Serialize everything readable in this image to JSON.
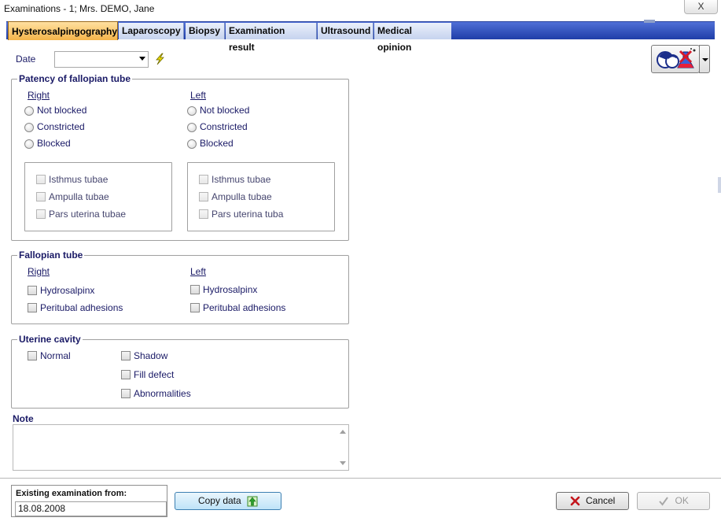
{
  "window": {
    "title": "Examinations - 1; Mrs. DEMO, Jane",
    "close_glyph": "X"
  },
  "tabs": [
    {
      "label": "Hysterosalpingography",
      "active": true
    },
    {
      "label": "Laparoscopy"
    },
    {
      "label": "Biopsy"
    },
    {
      "label": "Examination result"
    },
    {
      "label": "Ultrasound"
    },
    {
      "label": "Medical opinion"
    }
  ],
  "date": {
    "label": "Date",
    "value": ""
  },
  "patency": {
    "title": "Patency of fallopian tube",
    "right": {
      "heading": "Right",
      "options": [
        "Not blocked",
        "Constricted",
        "Blocked"
      ],
      "checks": [
        "Isthmus tubae",
        "Ampulla tubae",
        "Pars uterina tubae"
      ]
    },
    "left": {
      "heading": "Left",
      "options": [
        "Not blocked",
        "Constricted",
        "Blocked"
      ],
      "checks": [
        "Isthmus tubae",
        "Ampulla tubae",
        "Pars uterina tuba"
      ]
    }
  },
  "tube": {
    "title": "Fallopian tube",
    "right": {
      "heading": "Right",
      "checks": [
        "Hydrosalpinx",
        "Peritubal adhesions"
      ]
    },
    "left": {
      "heading": "Left",
      "checks": [
        "Hydrosalpinx",
        "Peritubal adhesions"
      ]
    }
  },
  "uterine": {
    "title": "Uterine cavity",
    "col1": [
      "Normal"
    ],
    "col2": [
      "Shadow",
      "Fill defect",
      "Abnormalities"
    ]
  },
  "note": {
    "label": "Note",
    "value": ""
  },
  "footer": {
    "existing_label": "Existing examination from:",
    "existing_value": "18.08.2008",
    "copy_label": "Copy data",
    "cancel_label": "Cancel",
    "ok_label": "OK"
  },
  "colors": {
    "tab_active": "#f4b44a",
    "tab_bar": "#1f3ea8",
    "text": "#1a1a66"
  },
  "icons": [
    "close-icon",
    "dropdown-arrow-icon",
    "lightning-icon",
    "examination-tool-icon",
    "copy-data-icon",
    "cancel-icon",
    "ok-check-icon"
  ]
}
